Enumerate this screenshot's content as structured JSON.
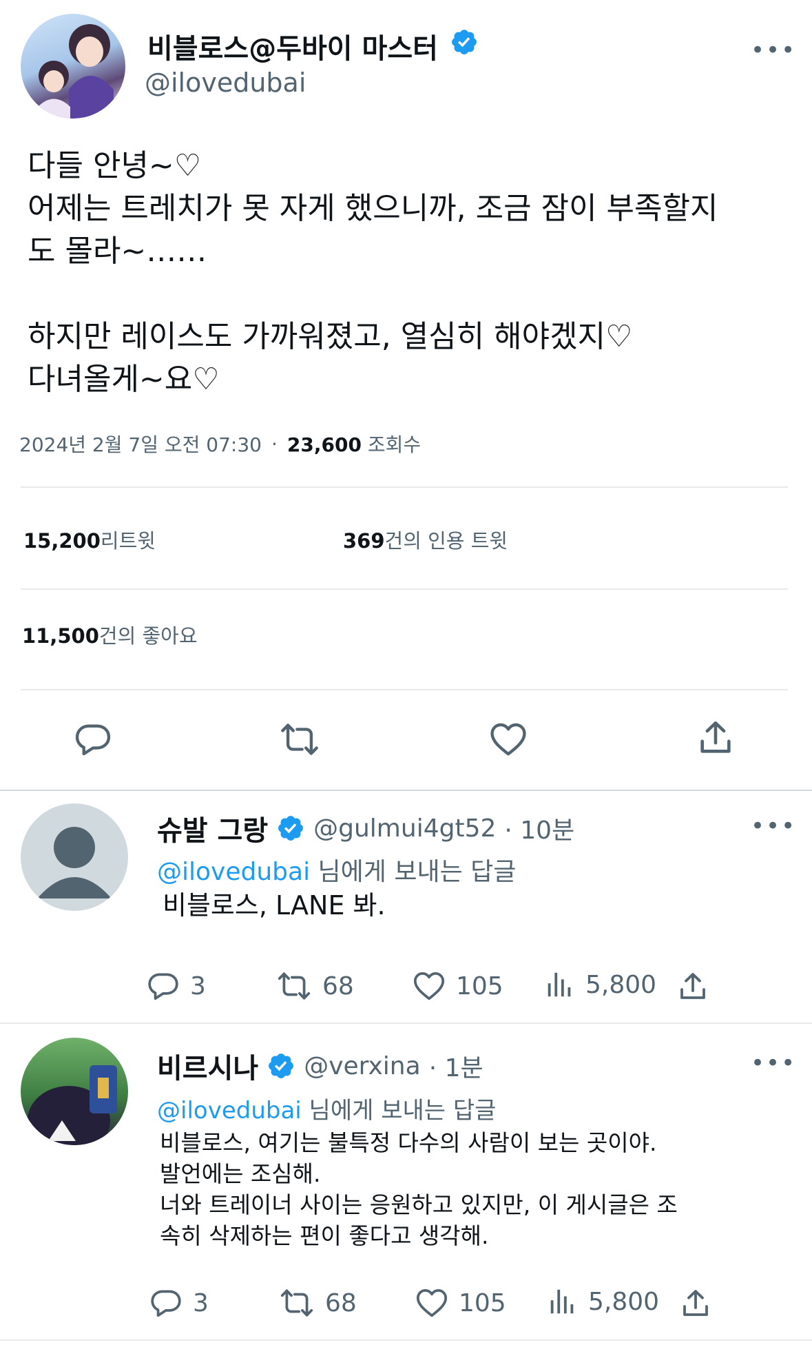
{
  "main_tweet": {
    "display_name": "비블로스@두바이 마스터",
    "handle": "@ilovedubai",
    "text_lines": [
      "다들 안녕~♡",
      "어제는 트레치가 못 자게 했으니까, 조금 잠이 부족할지",
      "도 몰라~……",
      "",
      "하지만 레이스도 가까워졌고, 열심히 해야겠지♡",
      "다녀올게~요♡"
    ],
    "timestamp": "2024년 2월 7일 오전 07:30",
    "separator": "·",
    "views_count": "23,600",
    "views_label": "조회수",
    "retweets_count": "15,200",
    "retweets_label": "리트윗",
    "quotes_count": "369",
    "quotes_label": "건의 인용 트윗",
    "likes_count": "11,500",
    "likes_label": "건의 좋아요"
  },
  "replies": [
    {
      "display_name": "슈발 그랑",
      "handle": "@gulmui4gt52",
      "time": "· 10분",
      "reply_to_handle": "@ilovedubai",
      "reply_to_suffix": "님에게 보내는 답글",
      "text_lines": [
        "비블로스, LANE 봐."
      ],
      "replies_count": "3",
      "retweets_count": "68",
      "likes_count": "105",
      "views_count": "5,800"
    },
    {
      "display_name": "비르시나",
      "handle": "@verxina",
      "time": "· 1분",
      "reply_to_handle": "@ilovedubai",
      "reply_to_suffix": "님에게 보내는 답글",
      "text_lines": [
        "비블로스, 여기는 불특정 다수의 사람이 보는 곳이야.",
        "발언에는 조심해.",
        "너와 트레이너 사이는 응원하고 있지만, 이 게시글은 조",
        "속히 삭제하는 편이 좋다고 생각해."
      ],
      "replies_count": "3",
      "retweets_count": "68",
      "likes_count": "105",
      "views_count": "5,800"
    }
  ],
  "icons": {
    "more": "more-icon",
    "verified": "verified-badge-icon",
    "reply": "reply-icon",
    "retweet": "retweet-icon",
    "like": "heart-icon",
    "share": "share-icon",
    "views": "views-chart-icon"
  },
  "colors": {
    "text": "#0f1419",
    "secondary": "#536471",
    "accent": "#1d9bf0",
    "divider": "#e7e9ea"
  }
}
